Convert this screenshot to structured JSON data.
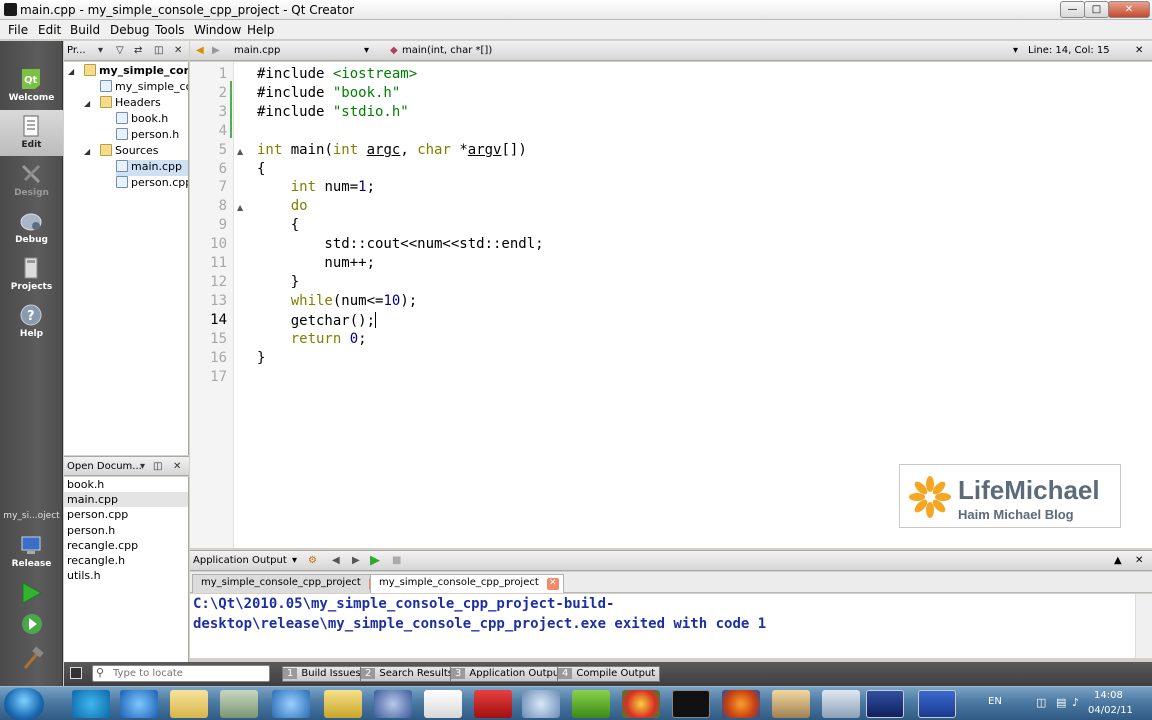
{
  "window": {
    "title": "main.cpp - my_simple_console_cpp_project - Qt Creator"
  },
  "menu": {
    "items": [
      "File",
      "Edit",
      "Build",
      "Debug",
      "Tools",
      "Window",
      "Help"
    ]
  },
  "modes": {
    "welcome": "Welcome",
    "edit": "Edit",
    "design": "Design",
    "debug": "Debug",
    "projects": "Projects",
    "help": "Help",
    "target_project": "my_si...oject",
    "build_config": "Release"
  },
  "navigation": {
    "title": "Pr...",
    "tree": [
      {
        "label": "my_simple_console",
        "type": "project"
      },
      {
        "label": "my_simple_console",
        "type": "file"
      },
      {
        "label": "Headers",
        "type": "folder"
      },
      {
        "label": "book.h",
        "type": "header"
      },
      {
        "label": "person.h",
        "type": "header"
      },
      {
        "label": "Sources",
        "type": "folder"
      },
      {
        "label": "main.cpp",
        "type": "source"
      },
      {
        "label": "person.cpp",
        "type": "source"
      }
    ]
  },
  "open_documents": {
    "title": "Open Docum...",
    "items": [
      "book.h",
      "main.cpp",
      "person.cpp",
      "person.h",
      "recangle.cpp",
      "recangle.h",
      "utils.h"
    ],
    "selected": "main.cpp"
  },
  "editor": {
    "file": "main.cpp",
    "symbol": "main(int, char *[])",
    "position": "Line: 14, Col: 15",
    "current_line": 14,
    "line_numbers": [
      "1",
      "2",
      "3",
      "4",
      "5",
      "6",
      "7",
      "8",
      "9",
      "10",
      "11",
      "12",
      "13",
      "14",
      "15",
      "16",
      "17"
    ]
  },
  "watermark": {
    "title": "LifeMichael",
    "subtitle": "Haim Michael Blog",
    "accent": "#f5a623"
  },
  "output": {
    "pane_title": "Application Output",
    "tabs": [
      "my_simple_console_cpp_project",
      "my_simple_console_cpp_project"
    ],
    "lines": [
      "C:\\Qt\\2010.05\\my_simple_console_cpp_project-build-",
      "desktop\\release\\my_simple_console_cpp_project.exe exited with code 1"
    ]
  },
  "statusbar": {
    "locator_placeholder": "Type to locate",
    "panes": [
      {
        "num": "1",
        "label": "Build Issues"
      },
      {
        "num": "2",
        "label": "Search Results"
      },
      {
        "num": "3",
        "label": "Application Output"
      },
      {
        "num": "4",
        "label": "Compile Output"
      }
    ]
  },
  "taskbar": {
    "language": "EN",
    "time": "14:08",
    "date": "04/02/11"
  },
  "colors": {
    "keyword": "#808000",
    "string": "#008000",
    "number": "#000080",
    "output_text": "#1c2fa4"
  }
}
